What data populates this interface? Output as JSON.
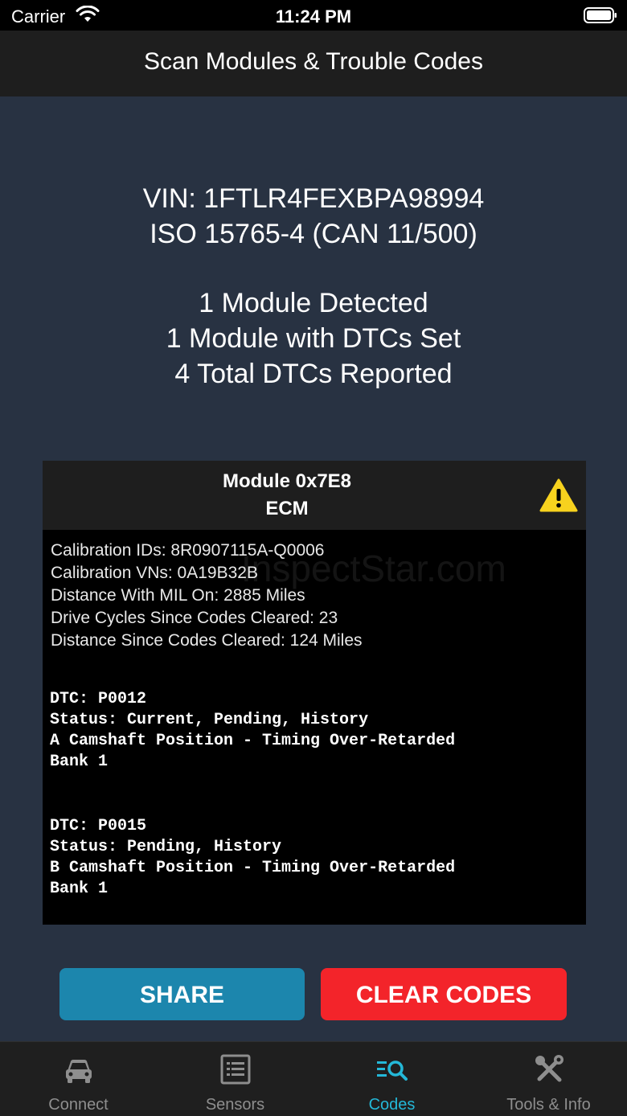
{
  "status_bar": {
    "carrier": "Carrier",
    "time": "11:24 PM"
  },
  "nav": {
    "title": "Scan Modules & Trouble Codes"
  },
  "summary": {
    "vin": "VIN: 1FTLR4FEXBPA98994",
    "protocol": "ISO 15765-4 (CAN 11/500)",
    "modules_detected": "1 Module Detected",
    "modules_with_dtcs": "1 Module with DTCs Set",
    "total_dtcs": "4 Total DTCs Reported"
  },
  "module": {
    "title": "Module 0x7E8",
    "subtitle": "ECM",
    "info": [
      "Calibration IDs: 8R0907115A-Q0006",
      "Calibration VNs: 0A19B32B",
      "Distance With MIL On: 2885 Miles",
      "Drive Cycles Since Codes Cleared: 23",
      "Distance Since Codes Cleared: 124 Miles"
    ],
    "dtcs": [
      {
        "code": "DTC: P0012",
        "status": "Status: Current, Pending, History",
        "desc1": "A Camshaft Position - Timing Over-Retarded",
        "desc2": "Bank 1"
      },
      {
        "code": "DTC: P0015",
        "status": "Status: Pending, History",
        "desc1": "B Camshaft Position - Timing Over-Retarded",
        "desc2": "Bank 1"
      }
    ]
  },
  "watermark": "InspectStar.com",
  "buttons": {
    "share": "SHARE",
    "clear": "CLEAR CODES"
  },
  "tabs": [
    {
      "label": "Connect",
      "icon": "car-icon"
    },
    {
      "label": "Sensors",
      "icon": "list-icon"
    },
    {
      "label": "Codes",
      "icon": "search-list-icon"
    },
    {
      "label": "Tools & Info",
      "icon": "tools-icon"
    }
  ],
  "colors": {
    "background": "#283242",
    "share": "#1c86ad",
    "clear": "#f3242a",
    "active_tab": "#24b8d8",
    "warning": "#f7d21e"
  }
}
